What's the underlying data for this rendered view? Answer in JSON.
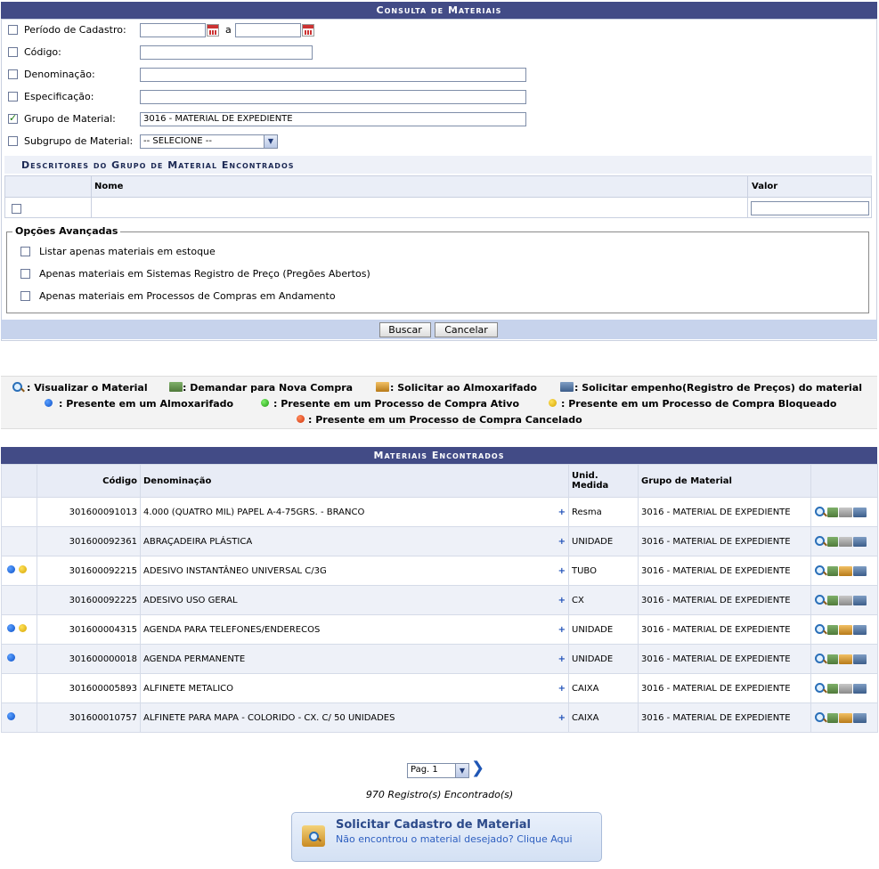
{
  "consulta": {
    "title": "Consulta de Materiais",
    "periodo_label": "Período de Cadastro:",
    "periodo_sep": "a",
    "codigo_label": "Código:",
    "denominacao_label": "Denominação:",
    "especificacao_label": "Especificação:",
    "grupo_label": "Grupo de Material:",
    "grupo_value": "3016 - MATERIAL DE EXPEDIENTE",
    "subgrupo_label": "Subgrupo de Material:",
    "subgrupo_value": "-- SELECIONE --",
    "descritores_title": "Descritores do Grupo de Material Encontrados",
    "desc_col_nome": "Nome",
    "desc_col_valor": "Valor",
    "opcoes_title": "Opções Avançadas",
    "opcao1": "Listar apenas materiais em estoque",
    "opcao2": "Apenas materiais em Sistemas Registro de Preço (Pregões Abertos)",
    "opcao3": "Apenas materiais em Processos de Compras em Andamento",
    "buscar": "Buscar",
    "cancelar": "Cancelar"
  },
  "legend": {
    "visualizar": ": Visualizar o Material",
    "demandar": ": Demandar para Nova Compra",
    "solicitar_alm": ": Solicitar ao Almoxarifado",
    "solicitar_emp": ": Solicitar empenho(Registro de Preços) do material",
    "presente_alm": ": Presente em um Almoxarifado",
    "presente_ativo": ": Presente em um Processo de Compra Ativo",
    "presente_bloq": ": Presente em um Processo de Compra Bloqueado",
    "presente_canc": ": Presente em um Processo de Compra Cancelado"
  },
  "resultados": {
    "title": "Materiais Encontrados",
    "col_codigo": "Código",
    "col_denominacao": "Denominação",
    "col_unid1": "Unid.",
    "col_unid2": "Medida",
    "col_grupo": "Grupo de Material",
    "rows": [
      {
        "dots": [],
        "codigo": "301600091013",
        "denominacao": "4.000 (QUATRO MIL) PAPEL A-4-75GRS. - BRANCO",
        "unid": "Resma",
        "grupo": "3016 - MATERIAL DE EXPEDIENTE"
      },
      {
        "dots": [],
        "codigo": "301600092361",
        "denominacao": "ABRAÇADEIRA PLÁSTICA",
        "unid": "UNIDADE",
        "grupo": "3016 - MATERIAL DE EXPEDIENTE"
      },
      {
        "dots": [
          "blue",
          "yellow"
        ],
        "codigo": "301600092215",
        "denominacao": "ADESIVO INSTANTÂNEO UNIVERSAL C/3G",
        "unid": "TUBO",
        "grupo": "3016 - MATERIAL DE EXPEDIENTE"
      },
      {
        "dots": [],
        "codigo": "301600092225",
        "denominacao": "ADESIVO USO GERAL",
        "unid": "CX",
        "grupo": "3016 - MATERIAL DE EXPEDIENTE"
      },
      {
        "dots": [
          "blue",
          "yellow"
        ],
        "codigo": "301600004315",
        "denominacao": "AGENDA PARA TELEFONES/ENDERECOS",
        "unid": "UNIDADE",
        "grupo": "3016 - MATERIAL DE EXPEDIENTE"
      },
      {
        "dots": [
          "blue"
        ],
        "codigo": "301600000018",
        "denominacao": "AGENDA PERMANENTE",
        "unid": "UNIDADE",
        "grupo": "3016 - MATERIAL DE EXPEDIENTE"
      },
      {
        "dots": [],
        "codigo": "301600005893",
        "denominacao": "ALFINETE METALICO",
        "unid": "CAIXA",
        "grupo": "3016 - MATERIAL DE EXPEDIENTE"
      },
      {
        "dots": [
          "blue"
        ],
        "codigo": "301600010757",
        "denominacao": "ALFINETE PARA MAPA - COLORIDO - CX. C/ 50 UNIDADES",
        "unid": "CAIXA",
        "grupo": "3016 - MATERIAL DE EXPEDIENTE"
      }
    ]
  },
  "paginacao": {
    "page_value": "Pag. 1",
    "registros": "970 Registro(s) Encontrado(s)"
  },
  "solicitar": {
    "title": "Solicitar Cadastro de Material",
    "subtitle": "Não encontrou o material desejado? Clique Aqui"
  }
}
